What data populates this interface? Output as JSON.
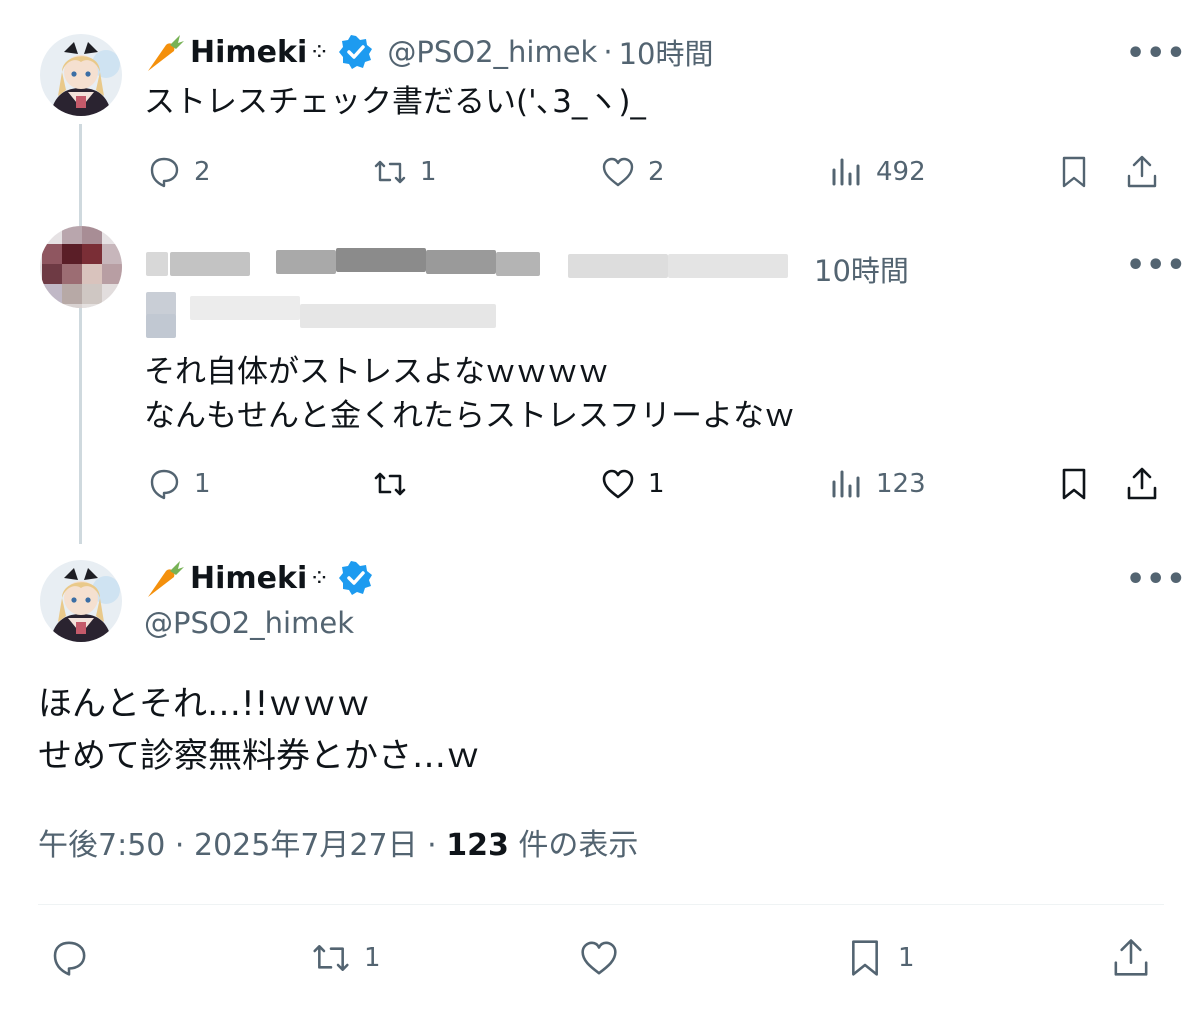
{
  "tweet1": {
    "display_name": "Himeki",
    "sparkle": "⁘",
    "handle": "@PSO2_himek",
    "sep": "·",
    "time": "10時間",
    "text": "ストレスチェック書だるい('､3_ヽ)_",
    "stats": {
      "replies": "2",
      "retweets": "1",
      "likes": "2",
      "views": "492"
    }
  },
  "tweet2": {
    "time": "10時間",
    "text_line1": "それ自体がストレスよなｗｗｗｗ",
    "text_line2": "なんもせんと金くれたらストレスフリーよなｗ",
    "stats": {
      "replies": "1",
      "likes": "1",
      "views": "123"
    }
  },
  "main": {
    "display_name": "Himeki",
    "sparkle": "⁘",
    "handle": "@PSO2_himek",
    "text_line1": "ほんとそれ…!!ｗｗｗ",
    "text_line2": "せめて診察無料券とかさ…ｗ",
    "meta_time": "午後7:50 · 2025年7月27日 · ",
    "meta_views": "123",
    "meta_views_suffix": " 件の表示",
    "stats": {
      "retweets": "1",
      "bookmarks": "1"
    }
  },
  "more_label": "•••",
  "colors": {
    "verified": "#1d9bf0",
    "muted": "#536471",
    "text": "#0f1419",
    "thread": "#cfd9de"
  }
}
